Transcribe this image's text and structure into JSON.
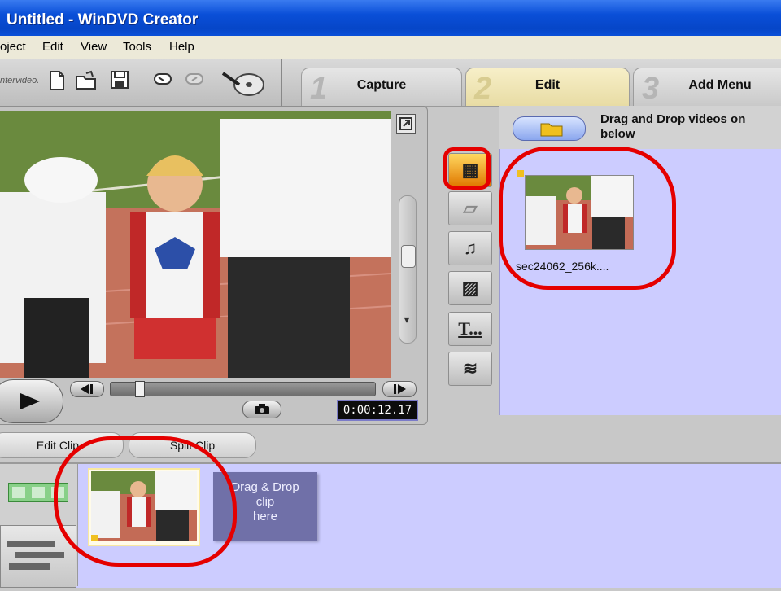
{
  "window": {
    "title": "Untitled - WinDVD Creator"
  },
  "menu": [
    "oject",
    "Edit",
    "View",
    "Tools",
    "Help"
  ],
  "toolbar": {
    "logo_text": "ntervideo.",
    "icons": [
      "new-file-icon",
      "open-folder-icon",
      "save-icon",
      "undo-icon",
      "redo-icon",
      "burn-disc-icon"
    ]
  },
  "steps": [
    {
      "num": "1",
      "label": "Capture"
    },
    {
      "num": "2",
      "label": "Edit"
    },
    {
      "num": "3",
      "label": "Add Menu"
    }
  ],
  "preview": {
    "timecode": "0:00:12.17"
  },
  "library": {
    "instruction_line1": "Drag and Drop videos on",
    "instruction_line2": "below",
    "clips": [
      {
        "name": "sec24062_256k...."
      }
    ]
  },
  "side_tools": [
    "video-clips-icon",
    "image-icon",
    "music-icon",
    "transition-icon",
    "text-title-icon",
    "effects-icon"
  ],
  "edit_buttons": {
    "edit_clip": "Edit Clip",
    "split_clip": "Split Clip"
  },
  "timeline": {
    "dropzone_line1": "Drag & Drop",
    "dropzone_line2": "clip",
    "dropzone_line3": "here"
  },
  "colors": {
    "titlebar": "#0a4fd8",
    "library_bg": "#ccccff",
    "annotation_red": "#e50000"
  }
}
